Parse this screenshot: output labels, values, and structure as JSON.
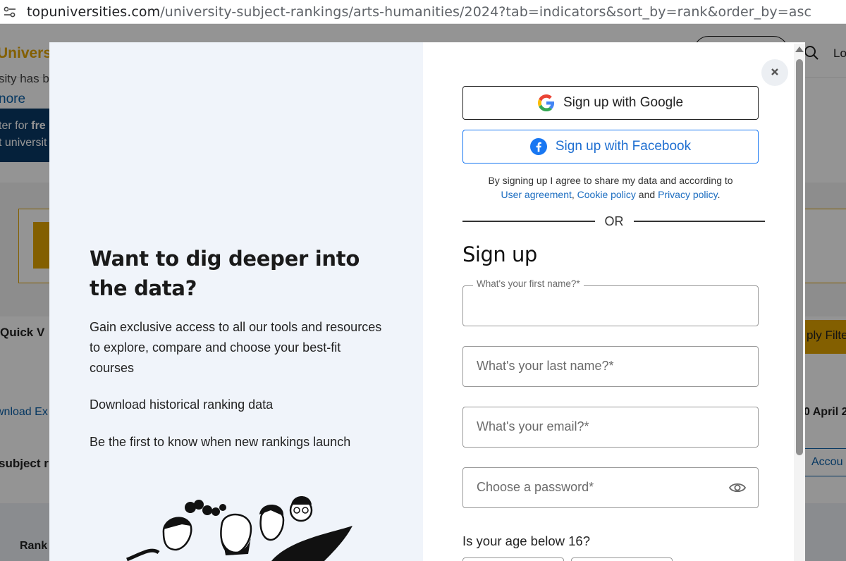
{
  "browser": {
    "url_host": "topuniversities.com",
    "url_path": "/university-subject-rankings/arts-humanities/2024?tab=indicators&sort_by=rank&order_by=asc"
  },
  "background": {
    "logo_text": "Universi",
    "login": "Lo",
    "text1": "sity has b",
    "more": "nore",
    "register_line1_a": "ter for ",
    "register_line1_b": "fre",
    "register_line2": "t universit",
    "quick_view": "Quick V",
    "apply_filters": "ply Filte",
    "download": "wnload Ex",
    "april": "0 April 2",
    "subject": "subject r",
    "account": "Accou",
    "rank": "Rank"
  },
  "promo": {
    "title": "Want to dig deeper into the data?",
    "p1": "Gain exclusive access to all our tools and resources to explore, compare and choose your best-fit courses",
    "p2": "Download historical ranking data",
    "p3": "Be the first to know when new rankings launch"
  },
  "signup": {
    "google_label": "Sign up with Google",
    "facebook_label": "Sign up with Facebook",
    "terms_prefix": "By signing up I agree to share my data and according to",
    "terms_link1": "User agreement",
    "terms_sep": ", ",
    "terms_link2": "Cookie policy",
    "terms_and": " and ",
    "terms_link3": "Privacy policy",
    "terms_end": ".",
    "or": "OR",
    "title": "Sign up",
    "first_name_label": "What's your first name?*",
    "last_name_placeholder": "What's your last name?*",
    "email_placeholder": "What's your email?*",
    "password_placeholder": "Choose a password*",
    "age_question": "Is your age below 16?"
  },
  "colors": {
    "google_border": "#222222",
    "facebook_blue": "#1877f2",
    "link_blue": "#1a6cc0",
    "promo_bg": "#f0f4fa",
    "brand_gold": "#e2a400"
  },
  "icons": {
    "close": "close-icon",
    "google": "google-icon",
    "facebook": "facebook-icon",
    "eye": "eye-icon"
  }
}
